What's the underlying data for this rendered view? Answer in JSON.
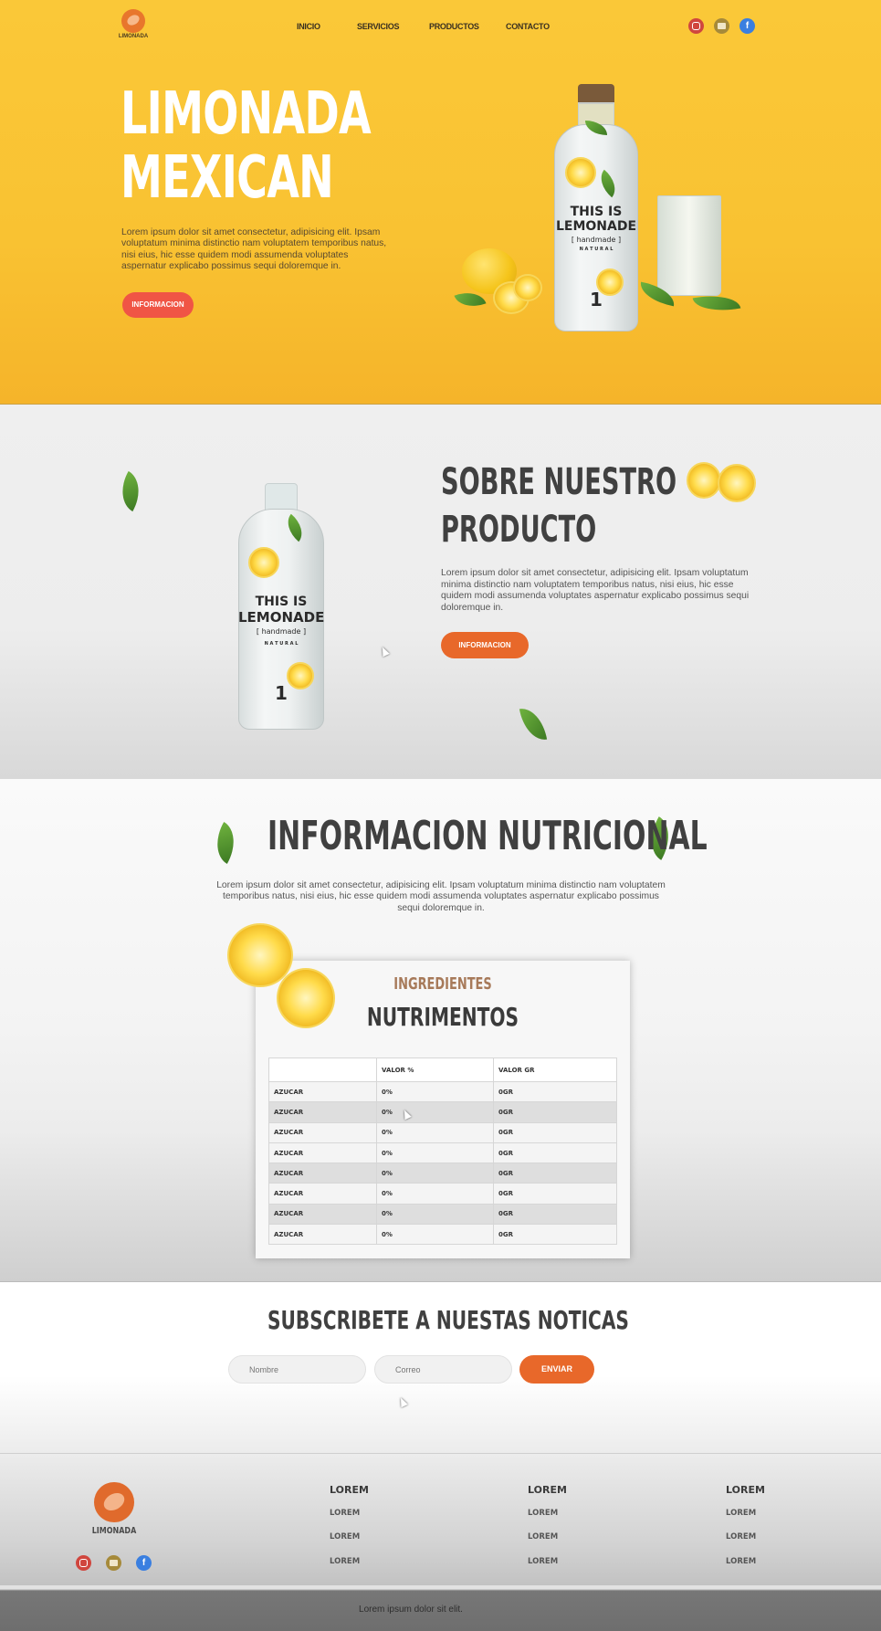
{
  "brand": {
    "name": "LIMONADA"
  },
  "nav": {
    "items": [
      "INICIO",
      "SERVICIOS",
      "PRODUCTOS",
      "CONTACTO"
    ]
  },
  "hero": {
    "title_line1": "LIMONADA",
    "title_line2": "MEXICAN",
    "text": "Lorem ipsum dolor sit amet consectetur, adipisicing elit. Ipsam voluptatum minima distinctio nam voluptatem temporibus natus, nisi eius, hic esse quidem modi assumenda voluptates aspernatur explicabo possimus sequi doloremque in.",
    "button": "INFORMACION",
    "bottle": {
      "line1": "THIS IS",
      "line2": "LEMONADE",
      "line3": "[ handmade ]",
      "line4": "N A T U R A L",
      "number": "1"
    }
  },
  "about": {
    "title_line1": "SOBRE NUESTRO",
    "title_line2": "PRODUCTO",
    "text": "Lorem ipsum dolor sit amet consectetur, adipisicing elit. Ipsam voluptatum minima distinctio nam voluptatem temporibus natus, nisi eius, hic esse quidem modi assumenda voluptates aspernatur explicabo possimus sequi doloremque in.",
    "button": "INFORMACION",
    "bottle": {
      "line1": "THIS IS",
      "line2": "LEMONADE",
      "line3": "[ handmade ]",
      "line4": "N A T U R A L",
      "number": "1"
    }
  },
  "nutrition": {
    "title": "INFORMACION NUTRICIONAL",
    "text": "Lorem ipsum dolor sit amet consectetur, adipisicing elit. Ipsam voluptatum minima distinctio nam voluptatem temporibus natus, nisi eius, hic esse quidem modi assumenda voluptates aspernatur explicabo possimus sequi doloremque in.",
    "card_subtitle": "INGREDIENTES",
    "card_title": "NUTRIMENTOS",
    "table": {
      "headers": [
        "",
        "VALOR %",
        "VALOR GR"
      ],
      "rows": [
        [
          "AZUCAR",
          "0%",
          "0GR"
        ],
        [
          "AZUCAR",
          "0%",
          "0GR"
        ],
        [
          "AZUCAR",
          "0%",
          "0GR"
        ],
        [
          "AZUCAR",
          "0%",
          "0GR"
        ],
        [
          "AZUCAR",
          "0%",
          "0GR"
        ],
        [
          "AZUCAR",
          "0%",
          "0GR"
        ],
        [
          "AZUCAR",
          "0%",
          "0GR"
        ],
        [
          "AZUCAR",
          "0%",
          "0GR"
        ]
      ]
    }
  },
  "subscribe": {
    "title": "SUBSCRIBETE A NUESTAS NOTICAS",
    "name_placeholder": "Nombre",
    "email_placeholder": "Correo",
    "button": "ENVIAR"
  },
  "footer": {
    "brand": "LIMONADA",
    "columns": [
      {
        "heading": "LOREM",
        "items": [
          "LOREM",
          "LOREM",
          "LOREM"
        ]
      },
      {
        "heading": "LOREM",
        "items": [
          "LOREM",
          "LOREM",
          "LOREM"
        ]
      },
      {
        "heading": "LOREM",
        "items": [
          "LOREM",
          "LOREM",
          "LOREM"
        ]
      }
    ],
    "copyright": "Lorem ipsum dolor sit elit."
  },
  "icons": {
    "social": [
      "instagram-icon",
      "messenger-icon",
      "facebook-icon"
    ],
    "brand": "lemon-logo-icon"
  },
  "colors": {
    "hero_yellow": "#fac838",
    "accent_orange": "#e8682a",
    "accent_red": "#f05545",
    "title_gray": "#404040",
    "ingredients_brown": "#a77a5a"
  }
}
